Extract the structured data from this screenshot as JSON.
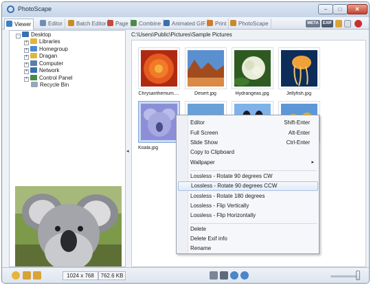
{
  "window": {
    "title": "PhotoScape",
    "min_glyph": "–",
    "max_glyph": "□",
    "close_glyph": "✕"
  },
  "tabs": [
    {
      "label": "Viewer",
      "icon": "viewer-icon",
      "color": "#3d7fc4",
      "active": true
    },
    {
      "label": "Editor",
      "icon": "editor-icon",
      "color": "#6c8fb8"
    },
    {
      "label": "Batch Editor",
      "icon": "batch-editor-icon",
      "color": "#c98b2a"
    },
    {
      "label": "Page",
      "icon": "page-icon",
      "color": "#c44a3b"
    },
    {
      "label": "Combine",
      "icon": "combine-icon",
      "color": "#4a8a4a"
    },
    {
      "label": "Animated GIF",
      "icon": "animated-gif-icon",
      "color": "#3a6fb0"
    },
    {
      "label": "Print",
      "icon": "print-icon",
      "color": "#d07a2a"
    },
    {
      "label": "PhotoScape",
      "icon": "photoscape-icon",
      "color": "#c98b2a"
    }
  ],
  "toolbar_right": {
    "btn1": "META",
    "btn2": "EXIF"
  },
  "tree": [
    {
      "label": "Desktop",
      "icon": "desktop-icon",
      "color": "#3a6fb0",
      "expander": "-"
    },
    {
      "label": "Libraries",
      "icon": "libraries-icon",
      "color": "#e2b53c",
      "expander": "+"
    },
    {
      "label": "Homegroup",
      "icon": "homegroup-icon",
      "color": "#4a8ad0",
      "expander": "+"
    },
    {
      "label": "Dragan",
      "icon": "user-folder-icon",
      "color": "#e2b53c",
      "expander": "+"
    },
    {
      "label": "Computer",
      "icon": "computer-icon",
      "color": "#5a7fa8",
      "expander": "+"
    },
    {
      "label": "Network",
      "icon": "network-icon",
      "color": "#3a6fb0",
      "expander": "+"
    },
    {
      "label": "Control Panel",
      "icon": "control-panel-icon",
      "color": "#4a8a4a",
      "expander": "+"
    },
    {
      "label": "Recycle Bin",
      "icon": "recycle-bin-icon",
      "color": "#9aa7b8",
      "expander": ""
    }
  ],
  "path": "C:\\Users\\Public\\Pictures\\Sample Pictures",
  "thumbnails": [
    {
      "caption": "Chrysanthemum....",
      "subject": "chrysanthemum"
    },
    {
      "caption": "Desert.jpg",
      "subject": "desert"
    },
    {
      "caption": "Hydrangeas.jpg",
      "subject": "hydrangeas"
    },
    {
      "caption": "Jellyfish.jpg",
      "subject": "jellyfish"
    },
    {
      "caption": "Koala.jpg",
      "subject": "koala",
      "selected": true
    },
    {
      "caption": "",
      "subject": "lighthouse"
    },
    {
      "caption": "",
      "subject": "penguins"
    },
    {
      "caption": "",
      "subject": "tulips"
    }
  ],
  "context_menu": {
    "items": [
      {
        "label": "Editor",
        "shortcut": "Shift-Enter"
      },
      {
        "label": "Full Screen",
        "shortcut": "Alt-Enter"
      },
      {
        "label": "Slide Show",
        "shortcut": "Ctrl-Enter"
      },
      {
        "label": "Copy to Clipboard",
        "shortcut": ""
      },
      {
        "label": "Wallpaper",
        "shortcut": "",
        "submenu": true
      },
      {
        "label": "Lossless - Rotate 90 degrees CW",
        "shortcut": ""
      },
      {
        "label": "Lossless - Rotate 90 degrees CCW",
        "shortcut": "",
        "highlighted": true
      },
      {
        "label": "Lossless - Rotate 180 degrees",
        "shortcut": ""
      },
      {
        "label": "Lossless - Flip Vertically",
        "shortcut": ""
      },
      {
        "label": "Lossless - Flip Horizontally",
        "shortcut": ""
      },
      {
        "label": "Delete",
        "shortcut": ""
      },
      {
        "label": "Delete Exif info",
        "shortcut": ""
      },
      {
        "label": "Rename",
        "shortcut": ""
      }
    ],
    "submenu_glyph": "▸"
  },
  "status": {
    "dimensions": "1024 x 768",
    "size": "762.6 KB",
    "splitter_glyph": "◂"
  },
  "colors": {
    "accent": "#3a6fb0",
    "selection": "#cddcf3",
    "menu_highlight_border": "#a9c0e3"
  }
}
